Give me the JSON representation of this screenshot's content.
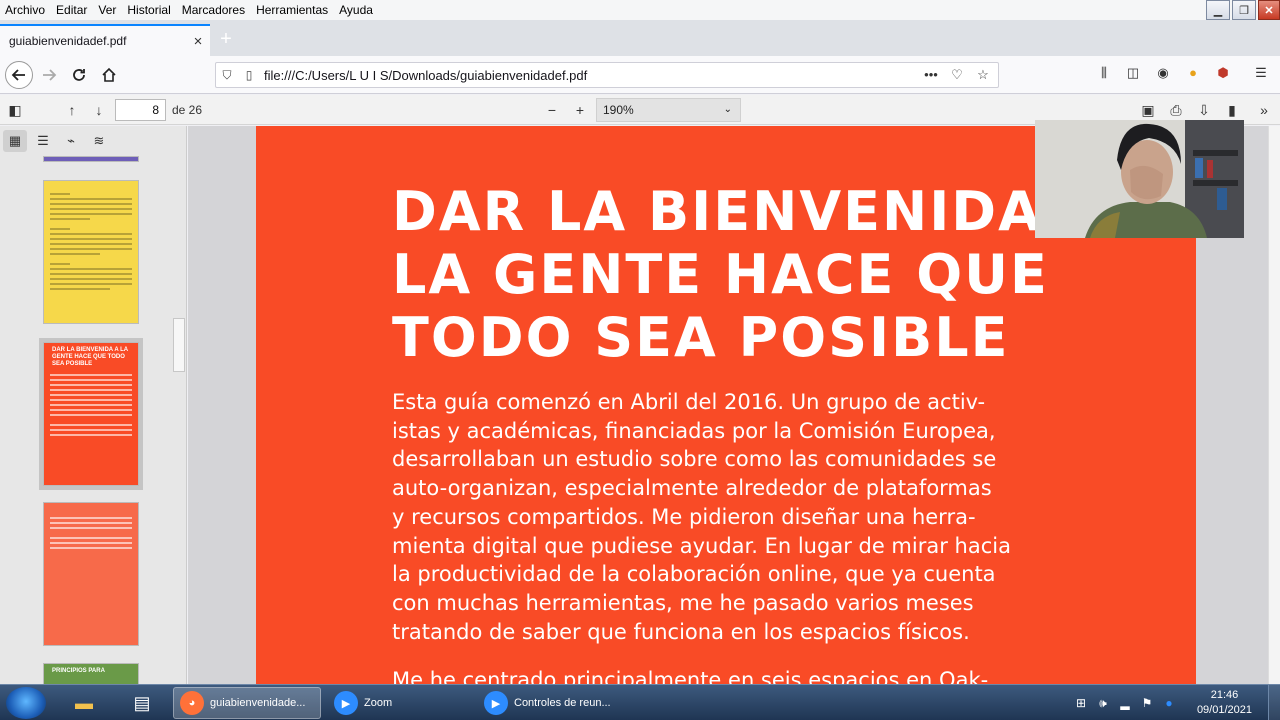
{
  "menu": [
    "Archivo",
    "Editar",
    "Ver",
    "Historial",
    "Marcadores",
    "Herramientas",
    "Ayuda"
  ],
  "tab": {
    "title": "guiabienvenidadef.pdf"
  },
  "urlbar": {
    "url": "file:///C:/Users/L U I S/Downloads/guiabienvenidadef.pdf"
  },
  "pdf_toolbar": {
    "page_number": "8",
    "page_count": "de 26",
    "zoom": "190%"
  },
  "thumbnails": [
    {
      "title": ""
    },
    {
      "title": ""
    },
    {
      "title": "DAR LA BIENVENIDA A LA GENTE HACE QUE TODO SEA POSIBLE"
    },
    {
      "title": ""
    },
    {
      "title": "PRINCIPIOS PARA"
    }
  ],
  "page": {
    "heading": "DAR LA BIENVENIDA A\nLA GENTE HACE QUE\nTODO SEA POSIBLE",
    "paragraph": "Esta guía comenzó en Abril del 2016. Un grupo de activ-\nistas y académicas, financiadas por la Comisión Europea,\ndesarrollaban un estudio sobre como las comunidades se\nauto-organizan, especialmente alrededor de plataformas\ny recursos compartidos. Me pidieron diseñar una herra-\nmienta digital que pudiese ayudar. En lugar de mirar hacia\nla productividad de la colaboración online, que ya cuenta\ncon muchas herramientas, me he pasado varios meses\ntratando de saber que funciona en los espacios físicos.",
    "paragraph2": "Me he centrado principalmente en seis espacios en Oak-"
  },
  "colors": {
    "page_bg": "#f94b26",
    "accent": "#0a84ff"
  },
  "taskbar": {
    "tasks": [
      {
        "label": "guiabienvenidade...",
        "icon": "firefox-icon"
      },
      {
        "label": "Zoom",
        "icon": "zoom-icon"
      },
      {
        "label": "Controles de reun...",
        "icon": "zoom-icon"
      }
    ],
    "time": "21:46",
    "date": "09/01/2021"
  }
}
